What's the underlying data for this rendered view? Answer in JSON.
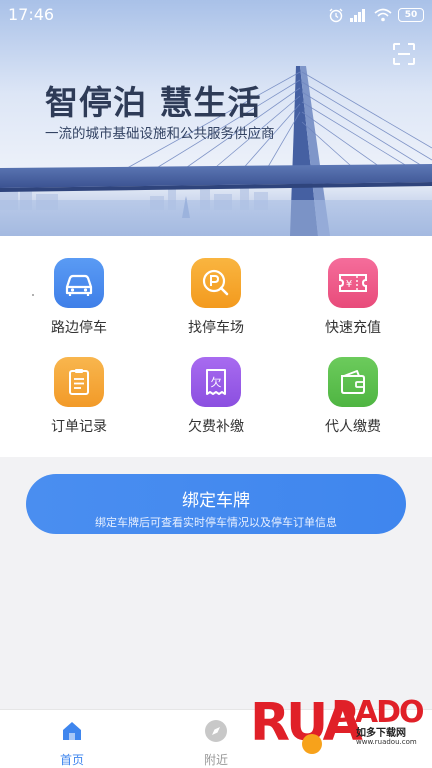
{
  "status_bar": {
    "time": "17:46",
    "battery": "50"
  },
  "banner": {
    "title": "智停泊 慧生活",
    "subtitle": "一流的城市基础设施和公共服务供应商"
  },
  "services": [
    {
      "label": "路边停车",
      "icon": "car-icon",
      "color": "#4a8cf1"
    },
    {
      "label": "找停车场",
      "icon": "parking-search-icon",
      "color": "#f5a623"
    },
    {
      "label": "快速充值",
      "icon": "ticket-icon",
      "color": "#ef5a8a"
    },
    {
      "label": "订单记录",
      "icon": "order-list-icon",
      "color": "#f6a43a"
    },
    {
      "label": "欠费补缴",
      "icon": "arrears-receipt-icon",
      "color": "#9b5de5"
    },
    {
      "label": "代人缴费",
      "icon": "wallet-icon",
      "color": "#5cbf4e"
    }
  ],
  "bind_plate": {
    "title": "绑定车牌",
    "subtitle": "绑定车牌后可查看实时停车情况以及停车订单信息"
  },
  "tabs": [
    {
      "label": "首页",
      "icon": "home-icon",
      "active": true
    },
    {
      "label": "附近",
      "icon": "compass-icon",
      "active": false
    }
  ],
  "watermark": {
    "brand": "RUANDADO",
    "sub": "如多下载网",
    "url": "www.ruadou.com"
  },
  "colors": {
    "accent": "#3f86ee",
    "tab_active": "#3f86ee",
    "tab_inactive": "#999999"
  }
}
